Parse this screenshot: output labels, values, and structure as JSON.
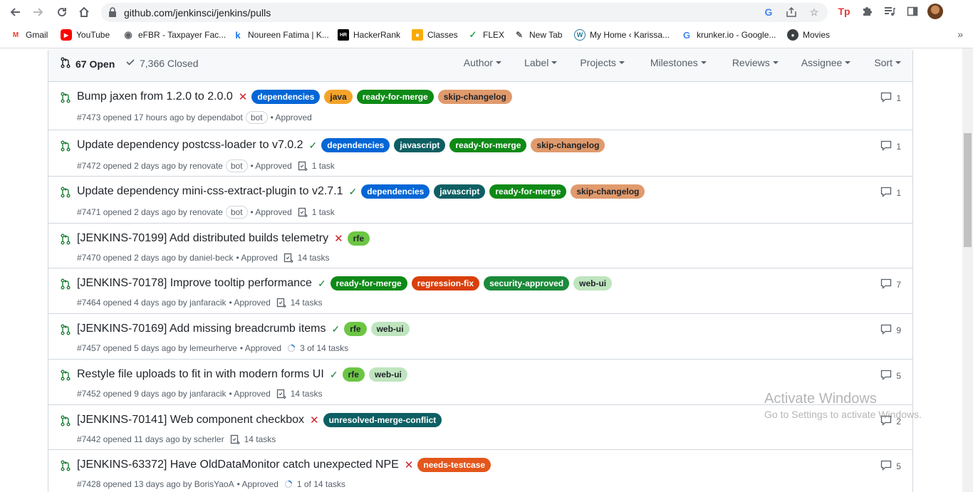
{
  "browser": {
    "url": "github.com/jenkinsci/jenkins/pulls",
    "bookmarks": [
      {
        "label": "Gmail",
        "icon": "gmail-icon",
        "color": "#ea4335"
      },
      {
        "label": "YouTube",
        "icon": "youtube-icon",
        "color": "#ff0000"
      },
      {
        "label": "eFBR - Taxpayer Fac...",
        "icon": "globe-icon",
        "color": "#5f6368"
      },
      {
        "label": "Noureen Fatima | K...",
        "icon": "k-icon",
        "color": "#1a73e8"
      },
      {
        "label": "HackerRank",
        "icon": "hackerrank-icon",
        "color": "#000000"
      },
      {
        "label": "Classes",
        "icon": "classes-icon",
        "color": "#f9ab00"
      },
      {
        "label": "FLEX",
        "icon": "flex-icon",
        "color": "#34a853"
      },
      {
        "label": "New Tab",
        "icon": "new-tab-icon",
        "color": "#5f6368"
      },
      {
        "label": "My Home ‹ Karissa...",
        "icon": "wordpress-icon",
        "color": "#21759b"
      },
      {
        "label": "krunker.io - Google...",
        "icon": "google-icon",
        "color": "#4285f4"
      },
      {
        "label": "Movies",
        "icon": "movies-icon",
        "color": "#3c4043"
      }
    ]
  },
  "header": {
    "open_label": "67 Open",
    "closed_label": "7,366 Closed",
    "filters": [
      "Author",
      "Label",
      "Projects",
      "Milestones",
      "Reviews",
      "Assignee",
      "Sort"
    ]
  },
  "labels_colors": {
    "dependencies": "#0366d6",
    "java": "#f4a32b",
    "ready-for-merge": "#0e8a16",
    "skip-changelog": "#e09a6c",
    "javascript": "#0d5f63",
    "rfe": "#6cc644",
    "regression-fix": "#d93f0b",
    "security-approved": "#1b8a3a",
    "web-ui": "#bfe5bf",
    "unresolved-merge-conflict": "#0d5f63",
    "needs-testcase": "#e4561b"
  },
  "pulls": [
    {
      "title": "Bump jaxen from 1.2.0 to 2.0.0",
      "status": "✕",
      "labels": [
        "dependencies",
        "java",
        "ready-for-merge",
        "skip-changelog"
      ],
      "meta": "#7473 opened 17 hours ago by dependabot",
      "bot": "bot",
      "review": "• Approved",
      "tasks": "",
      "comments": "1"
    },
    {
      "title": "Update dependency postcss-loader to v7.0.2",
      "status": "✓",
      "labels": [
        "dependencies",
        "javascript",
        "ready-for-merge",
        "skip-changelog"
      ],
      "meta": "#7472 opened 2 days ago by renovate",
      "bot": "bot",
      "review": "• Approved",
      "tasks": "1 task",
      "comments": "1"
    },
    {
      "title": "Update dependency mini-css-extract-plugin to v2.7.1",
      "status": "✓",
      "labels": [
        "dependencies",
        "javascript",
        "ready-for-merge",
        "skip-changelog"
      ],
      "meta": "#7471 opened 2 days ago by renovate",
      "bot": "bot",
      "review": "• Approved",
      "tasks": "1 task",
      "comments": "1"
    },
    {
      "title": "[JENKINS-70199] Add distributed builds telemetry",
      "status": "✕",
      "labels": [
        "rfe"
      ],
      "meta": "#7470 opened 2 days ago by daniel-beck",
      "bot": "",
      "review": "• Approved",
      "tasks": "14 tasks",
      "comments": ""
    },
    {
      "title": "[JENKINS-70178] Improve tooltip performance",
      "status": "✓",
      "labels": [
        "ready-for-merge",
        "regression-fix",
        "security-approved",
        "web-ui"
      ],
      "meta": "#7464 opened 4 days ago by janfaracik",
      "bot": "",
      "review": "• Approved",
      "tasks": "14 tasks",
      "comments": "7"
    },
    {
      "title": "[JENKINS-70169] Add missing breadcrumb items",
      "status": "✓",
      "labels": [
        "rfe",
        "web-ui"
      ],
      "meta": "#7457 opened 5 days ago by lemeurherve",
      "bot": "",
      "review": "• Approved",
      "tasks": "3 of 14 tasks",
      "comments": "9"
    },
    {
      "title": "Restyle file uploads to fit in with modern forms UI",
      "status": "✓",
      "labels": [
        "rfe",
        "web-ui"
      ],
      "meta": "#7452 opened 9 days ago by janfaracik",
      "bot": "",
      "review": "• Approved",
      "tasks": "14 tasks",
      "comments": "5"
    },
    {
      "title": "[JENKINS-70141] Web component checkbox",
      "status": "✕",
      "labels": [
        "unresolved-merge-conflict"
      ],
      "meta": "#7442 opened 11 days ago by scherler",
      "bot": "",
      "review": "",
      "tasks": "14 tasks",
      "comments": "2"
    },
    {
      "title": "[JENKINS-63372] Have OldDataMonitor catch unexpected NPE",
      "status": "✕",
      "labels": [
        "needs-testcase"
      ],
      "meta": "#7428 opened 13 days ago by BorisYaoA",
      "bot": "",
      "review": "• Approved",
      "tasks": "1 of 14 tasks",
      "comments": "5"
    }
  ],
  "watermark": {
    "line1": "Activate Windows",
    "line2": "Go to Settings to activate Windows."
  }
}
